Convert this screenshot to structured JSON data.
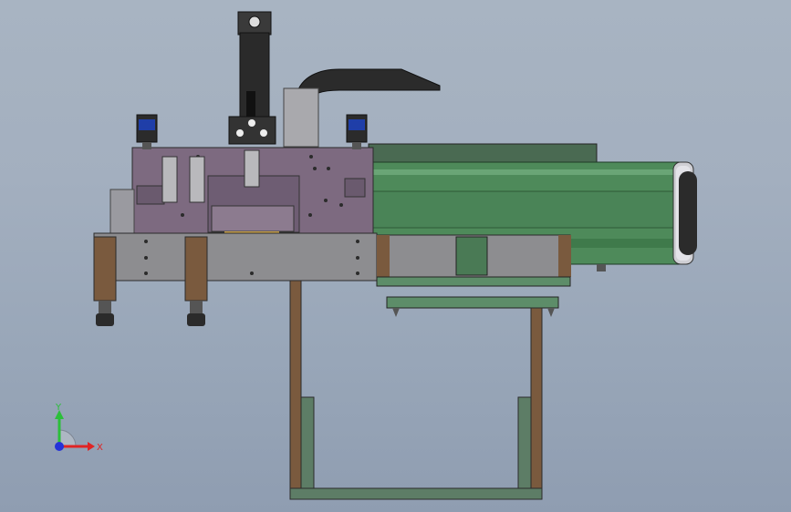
{
  "viewport": {
    "background_top": "#a8b4c2",
    "background_bottom": "#8f9db1"
  },
  "colors": {
    "plate_purple": "#7d6a80",
    "plate_grey": "#8d8d90",
    "rail_green": "#4e8a5a",
    "rail_green_light": "#6aa576",
    "frame_brown": "#7a5a3e",
    "frame_green": "#5d7d66",
    "cylinder_black": "#2a2a2a",
    "valve_blue": "#1f3ea8",
    "motor_grey": "#9a9aa0"
  },
  "triad": {
    "y_label": "Y",
    "x_label": "X",
    "y_color": "#2bbf3a",
    "x_color": "#e02424",
    "z_color": "#2432d8"
  }
}
